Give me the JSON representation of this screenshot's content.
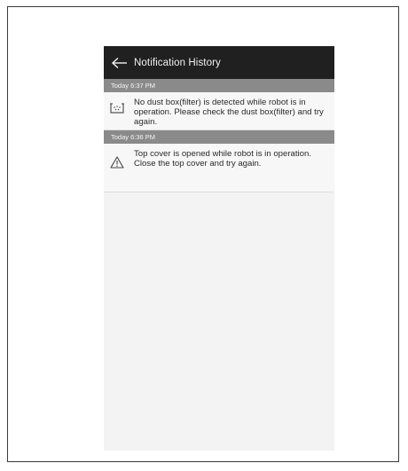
{
  "appbar": {
    "title": "Notification History",
    "back_icon": "arrow-left-icon"
  },
  "notifications": [
    {
      "timestamp": "Today 6:37 PM",
      "icon": "dust-box-icon",
      "message": "No dust box(filter) is detected while robot is in operation. Please check the dust box(filter) and try again."
    },
    {
      "timestamp": "Today 6:36 PM",
      "icon": "warning-triangle-icon",
      "message": "Top cover is opened while robot is in operation. Close the top cover and try again."
    }
  ],
  "colors": {
    "appbar_bg": "#202020",
    "section_header_bg": "#8a8a8a",
    "list_bg": "#f7f7f7",
    "screen_bg": "#f3f3f3"
  }
}
